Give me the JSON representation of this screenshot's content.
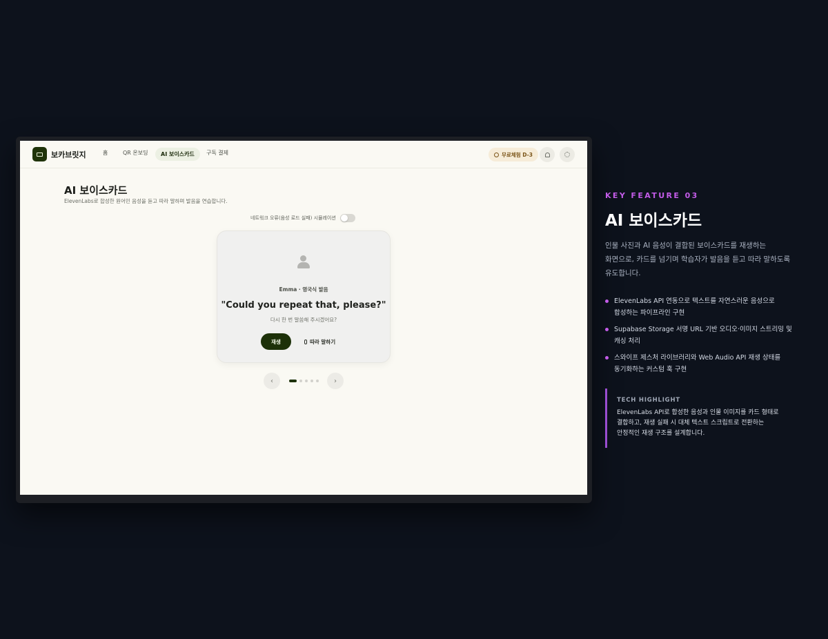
{
  "app": {
    "brand": "보카브릿지",
    "nav": {
      "items": [
        "홈",
        "QR 온보딩",
        "AI 보이스카드",
        "구독 결제"
      ],
      "active_index": 2
    },
    "trial_badge": "무료체험 D-3",
    "icons": {
      "notifications": "bell-icon",
      "settings": "gear-icon"
    }
  },
  "page": {
    "title": "AI 보이스카드",
    "subtitle": "ElevenLabs로 합성한 원어민 음성을 듣고 따라 말하며 발음을 연습합니다.",
    "simulation": {
      "label": "네트워크 오류(음성 로드 실패) 시뮬레이션",
      "enabled": false
    }
  },
  "card": {
    "speaker": "Emma · 영국식 발음",
    "phrase": "\"Could you repeat that, please?\"",
    "translation": "다시 한 번 말씀해 주시겠어요?",
    "play_label": "재생",
    "repeat_label": "따라 말하기"
  },
  "pager": {
    "prev": "‹",
    "next": "›",
    "total": 5,
    "current": 1
  },
  "feature": {
    "kicker": "KEY FEATURE 03",
    "title": "AI 보이스카드",
    "description": [
      "인물 사진과 AI 음성이 결합된 보이스카드를 재생하는",
      "화면으로, 카드를 넘기며 학습자가 발음을 듣고 따라 말하도록",
      "유도합니다."
    ],
    "bullets": [
      [
        "ElevenLabs API 연동으로 텍스트를 자연스러운 음성으로",
        "합성하는 파이프라인 구현"
      ],
      [
        "Supabase Storage 서명 URL 기반 오디오·이미지 스트리밍 및",
        "캐싱 처리"
      ],
      [
        "스와이프 제스처 라이브러리와 Web Audio API 재생 상태를",
        "동기화하는 커스텀 훅 구현"
      ]
    ],
    "highlight": {
      "label": "TECH HIGHLIGHT",
      "lines": [
        "ElevenLabs API로 합성한 음성과 인물 이미지를 카드 형태로",
        "결합하고, 재생 실패 시 대체 텍스트 스크립트로 전환하는",
        "안정적인 재생 구조를 설계합니다."
      ]
    },
    "accent_color": "#c45ce9"
  }
}
